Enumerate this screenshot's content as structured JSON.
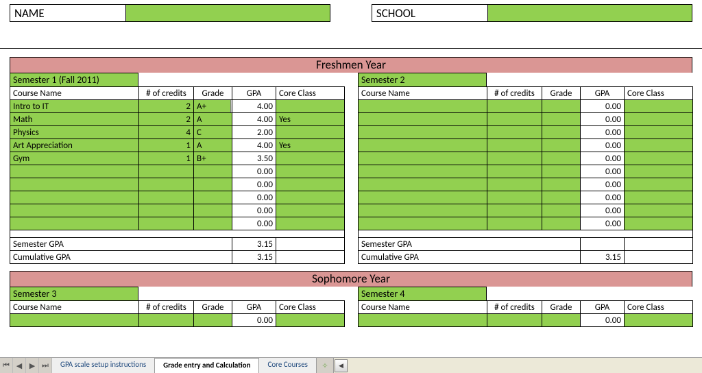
{
  "colors": {
    "green": "#92d050",
    "pink": "#da9694"
  },
  "header": {
    "name_label": "NAME",
    "name_value": "",
    "school_label": "SCHOOL",
    "school_value": ""
  },
  "columns": {
    "course": "Course Name",
    "credits": "# of credits",
    "grade": "Grade",
    "gpa": "GPA",
    "core": "Core Class"
  },
  "summary_labels": {
    "semester_gpa": "Semester GPA",
    "cumulative_gpa": "Cumulative GPA"
  },
  "years": [
    {
      "title": "Freshmen Year",
      "semesters": [
        {
          "title": "Semester 1 (Fall 2011)",
          "has_dropdown_row": 0,
          "rows": [
            {
              "course": "Intro to IT",
              "credits": "2",
              "grade": "A+",
              "gpa": "4.00",
              "core": ""
            },
            {
              "course": "Math",
              "credits": "2",
              "grade": "A",
              "gpa": "4.00",
              "core": "Yes"
            },
            {
              "course": "Physics",
              "credits": "4",
              "grade": "C",
              "gpa": "2.00",
              "core": ""
            },
            {
              "course": "Art Appreciation",
              "credits": "1",
              "grade": "A",
              "gpa": "4.00",
              "core": "Yes"
            },
            {
              "course": "Gym",
              "credits": "1",
              "grade": "B+",
              "gpa": "3.50",
              "core": ""
            },
            {
              "course": "",
              "credits": "",
              "grade": "",
              "gpa": "0.00",
              "core": ""
            },
            {
              "course": "",
              "credits": "",
              "grade": "",
              "gpa": "0.00",
              "core": ""
            },
            {
              "course": "",
              "credits": "",
              "grade": "",
              "gpa": "0.00",
              "core": ""
            },
            {
              "course": "",
              "credits": "",
              "grade": "",
              "gpa": "0.00",
              "core": ""
            },
            {
              "course": "",
              "credits": "",
              "grade": "",
              "gpa": "0.00",
              "core": ""
            }
          ],
          "semester_gpa": "3.15",
          "cumulative_gpa": "3.15"
        },
        {
          "title": "Semester 2",
          "rows": [
            {
              "course": "",
              "credits": "",
              "grade": "",
              "gpa": "0.00",
              "core": ""
            },
            {
              "course": "",
              "credits": "",
              "grade": "",
              "gpa": "0.00",
              "core": ""
            },
            {
              "course": "",
              "credits": "",
              "grade": "",
              "gpa": "0.00",
              "core": ""
            },
            {
              "course": "",
              "credits": "",
              "grade": "",
              "gpa": "0.00",
              "core": ""
            },
            {
              "course": "",
              "credits": "",
              "grade": "",
              "gpa": "0.00",
              "core": ""
            },
            {
              "course": "",
              "credits": "",
              "grade": "",
              "gpa": "0.00",
              "core": ""
            },
            {
              "course": "",
              "credits": "",
              "grade": "",
              "gpa": "0.00",
              "core": ""
            },
            {
              "course": "",
              "credits": "",
              "grade": "",
              "gpa": "0.00",
              "core": ""
            },
            {
              "course": "",
              "credits": "",
              "grade": "",
              "gpa": "0.00",
              "core": ""
            },
            {
              "course": "",
              "credits": "",
              "grade": "",
              "gpa": "0.00",
              "core": ""
            }
          ],
          "semester_gpa": "",
          "cumulative_gpa": "3.15"
        }
      ]
    },
    {
      "title": "Sophomore Year",
      "semesters": [
        {
          "title": "Semester 3",
          "rows": [
            {
              "course": "",
              "credits": "",
              "grade": "",
              "gpa": "0.00",
              "core": ""
            }
          ],
          "semester_gpa": "",
          "cumulative_gpa": ""
        },
        {
          "title": "Semester 4",
          "rows": [
            {
              "course": "",
              "credits": "",
              "grade": "",
              "gpa": "0.00",
              "core": ""
            }
          ],
          "semester_gpa": "",
          "cumulative_gpa": ""
        }
      ]
    }
  ],
  "tabs": {
    "items": [
      "GPA scale setup instructions",
      "Grade entry and Calculation",
      "Core Courses"
    ],
    "active_index": 1
  }
}
